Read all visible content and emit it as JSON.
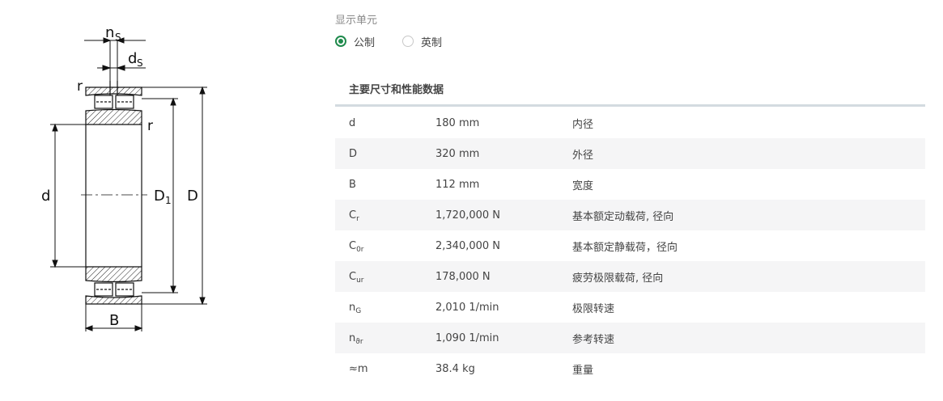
{
  "drawing": {
    "labels": {
      "ns_main": "n",
      "ns_sub": "S",
      "ds_main": "d",
      "ds_sub": "S",
      "r_top": "r",
      "r_mid": "r",
      "d": "d",
      "D1_main": "D",
      "D1_sub": "1",
      "D": "D",
      "B": "B"
    }
  },
  "units": {
    "label": "显示单元",
    "options": [
      {
        "label": "公制",
        "selected": true
      },
      {
        "label": "英制",
        "selected": false
      }
    ]
  },
  "table": {
    "title": "主要尺寸和性能数据",
    "rows": [
      {
        "symbol": "d",
        "sub": "",
        "value": "180 mm",
        "description": "内径"
      },
      {
        "symbol": "D",
        "sub": "",
        "value": "320 mm",
        "description": "外径"
      },
      {
        "symbol": "B",
        "sub": "",
        "value": "112 mm",
        "description": "宽度"
      },
      {
        "symbol": "C",
        "sub": "r",
        "value": "1,720,000 N",
        "description": "基本额定动载荷, 径向"
      },
      {
        "symbol": "C",
        "sub": "0r",
        "value": "2,340,000 N",
        "description": "基本额定静载荷，径向"
      },
      {
        "symbol": "C",
        "sub": "ur",
        "value": "178,000 N",
        "description": "疲劳极限载荷, 径向"
      },
      {
        "symbol": "n",
        "sub": "G",
        "value": "2,010 1/min",
        "description": "极限转速"
      },
      {
        "symbol": "n",
        "sub": "ϑr",
        "value": "1,090 1/min",
        "description": "参考转速"
      },
      {
        "symbol": "≈m",
        "sub": "",
        "value": "38.4 kg",
        "description": "重量"
      }
    ]
  },
  "colors": {
    "accent": "#1f8a4c",
    "stripe": "#f5f5f6",
    "rule": "#d3dbe0"
  }
}
